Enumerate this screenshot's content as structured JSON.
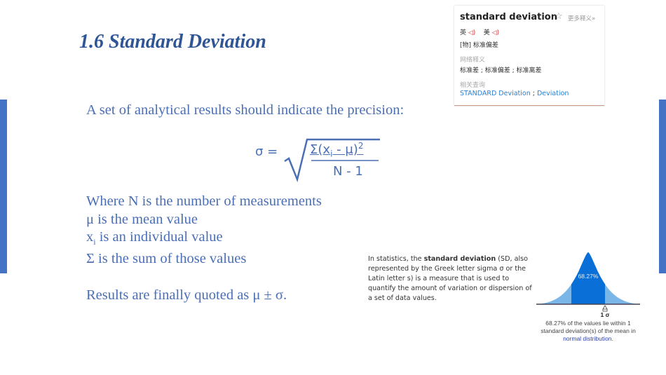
{
  "slide": {
    "title": "1.6 Standard Deviation",
    "intro": "A set of analytical results should indicate the precision:",
    "formula": {
      "lhs": "σ =",
      "numerator": "Σ(x",
      "sub": "i",
      "numerator_rest": " -  μ)",
      "exp": "2",
      "denominator": "N - 1"
    },
    "where": [
      {
        "sym": "Where N is the number of measurements"
      },
      {
        "sym": "μ is the mean value"
      },
      {
        "sym": "x",
        "sub": "i",
        "rest": " is an individual value"
      },
      {
        "sym": "Σ is the sum of those values"
      }
    ],
    "quote": "Results are finally quoted as μ  ±  σ."
  },
  "dictionary": {
    "word": "standard deviation",
    "star": "☆",
    "more": "更多释义»",
    "uk": "英",
    "us": "美",
    "speaker": "speaker-icon",
    "definition": "[物] 标准偏差",
    "web_label": "网络释义",
    "web_defs": "标准差 ; 标准偏差 ; 标准离差",
    "related_label": "相关查询",
    "related": [
      "STANDARD Deviation",
      "Deviation"
    ],
    "related_sep": " ; "
  },
  "wiki": {
    "pre": "In statistics, the ",
    "bold": "standard deviation",
    "post": " (SD, also represented by the Greek letter sigma σ or the Latin letter s) is a measure that is used to quantify the amount of variation or dispersion of a set of data values."
  },
  "figure": {
    "percent": "68.27%",
    "sigma_label": "1 σ",
    "caption": "68.27% of the values lie within 1 standard deviation(s) of the mean in ",
    "caption_link": "normal distribution",
    "caption_end": ".",
    "colors": {
      "dark": "#0a6fd6",
      "light": "#7ab6e8"
    }
  },
  "colors": {
    "accent": "#4472c4",
    "title": "#2f5597"
  }
}
